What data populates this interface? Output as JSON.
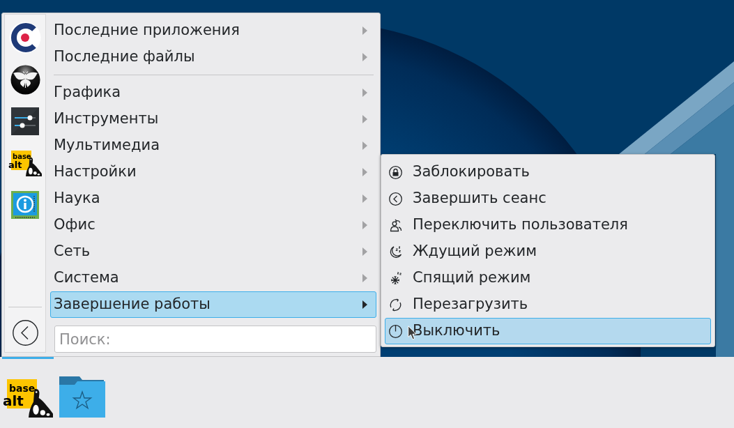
{
  "start_menu": {
    "logo_text": [
      "base",
      "alt"
    ],
    "items": [
      {
        "kind": "submenu",
        "label": "Последние приложения",
        "selected": false
      },
      {
        "kind": "submenu",
        "label": "Последние файлы",
        "selected": false
      },
      {
        "kind": "separator"
      },
      {
        "kind": "submenu",
        "label": "Графика",
        "selected": false
      },
      {
        "kind": "submenu",
        "label": "Инструменты",
        "selected": false
      },
      {
        "kind": "submenu",
        "label": "Мультимедиа",
        "selected": false
      },
      {
        "kind": "submenu",
        "label": "Настройки",
        "selected": false
      },
      {
        "kind": "submenu",
        "label": "Наука",
        "selected": false
      },
      {
        "kind": "submenu",
        "label": "Офис",
        "selected": false
      },
      {
        "kind": "submenu",
        "label": "Сеть",
        "selected": false
      },
      {
        "kind": "submenu",
        "label": "Система",
        "selected": false
      },
      {
        "kind": "submenu",
        "label": "Завершение работы",
        "selected": true
      }
    ],
    "search": {
      "placeholder": "Поиск:"
    }
  },
  "power_menu": {
    "items": [
      {
        "label": "Заблокировать",
        "selected": false
      },
      {
        "label": "Завершить сеанс",
        "selected": false
      },
      {
        "label": "Переключить пользователя",
        "selected": false
      },
      {
        "label": "Ждущий режим",
        "selected": false
      },
      {
        "label": "Спящий режим",
        "selected": false
      },
      {
        "label": "Перезагрузить",
        "selected": false
      },
      {
        "label": "Выключить",
        "selected": true
      }
    ]
  },
  "taskbar": {
    "launcher": {
      "active": true,
      "logo_text": [
        "base",
        "alt"
      ]
    }
  }
}
